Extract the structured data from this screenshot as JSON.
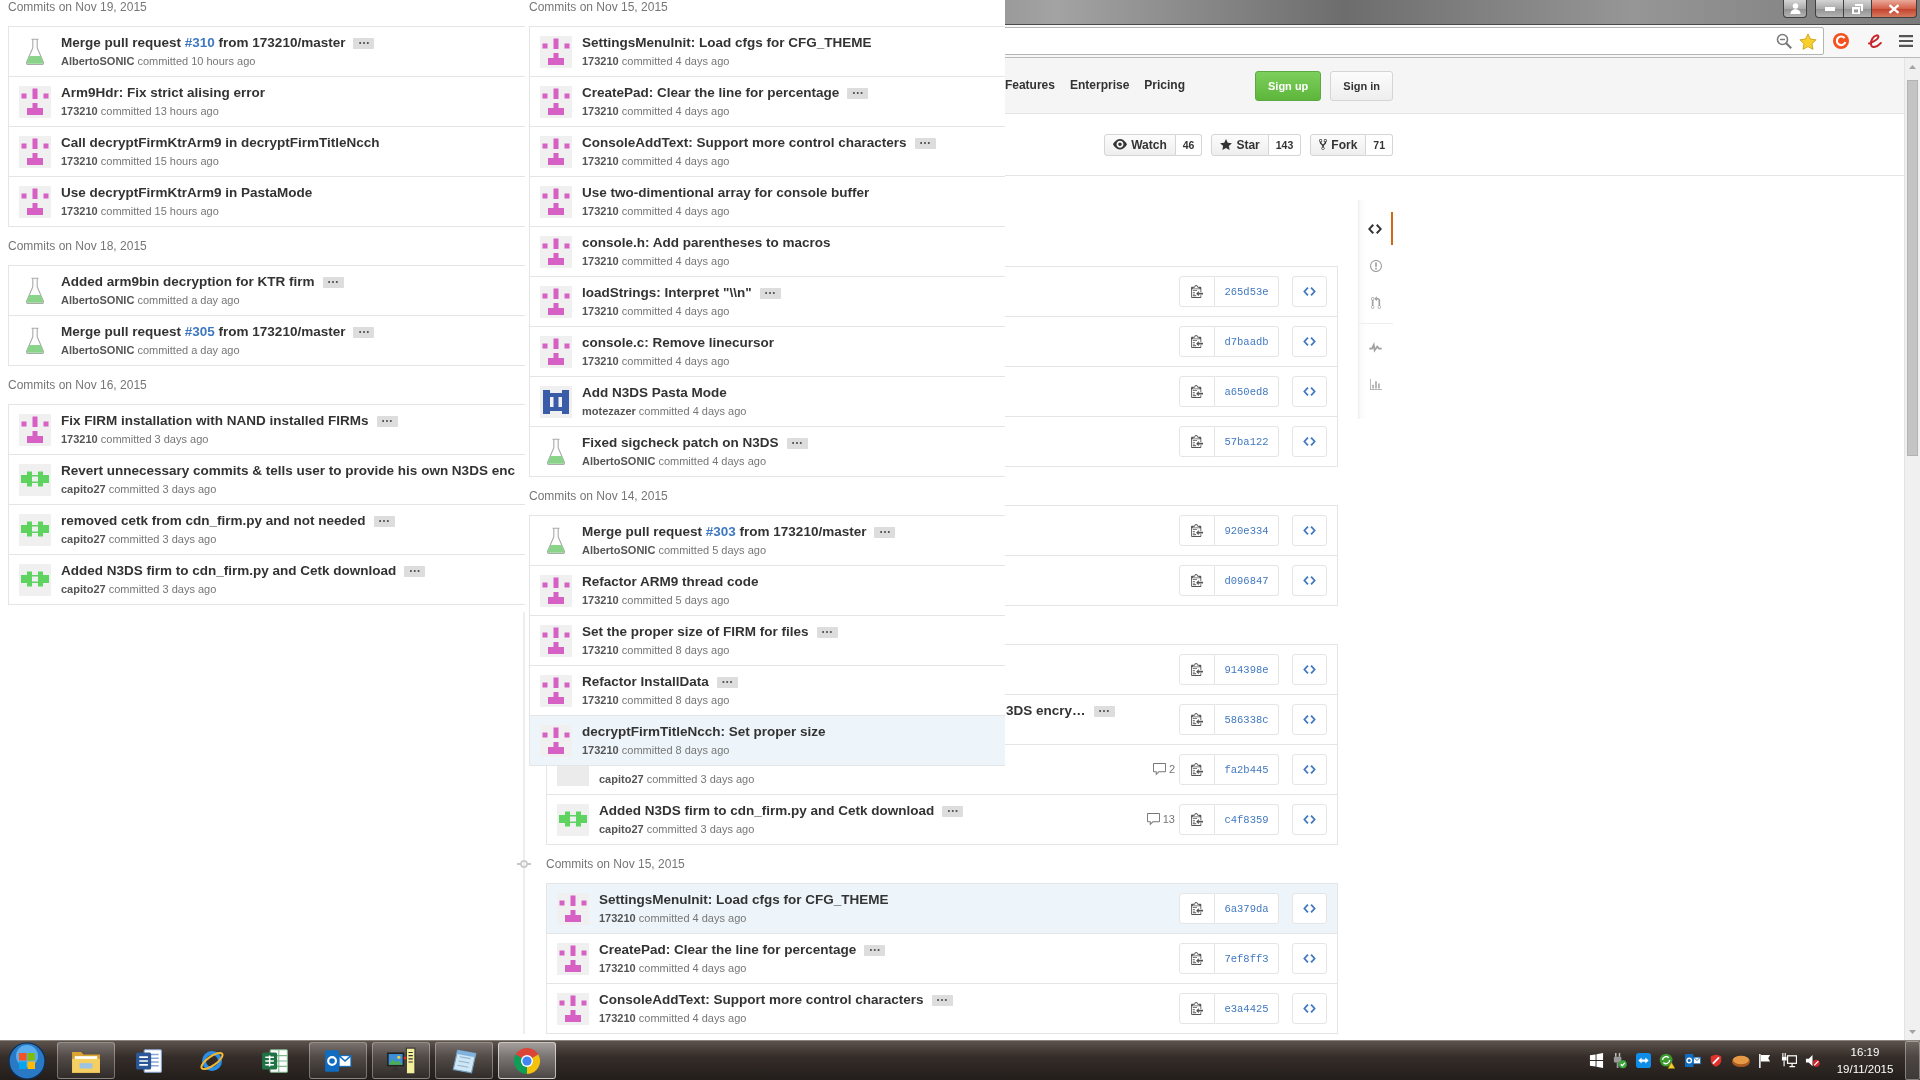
{
  "overlay_left": {
    "groups": [
      {
        "date": "Commits on Nov 19, 2015",
        "rows": [
          {
            "avatar": {
              "kind": "flask"
            },
            "title": "Merge pull request",
            "pr_link": "#310",
            "title_end": "from 173210/master",
            "expander": "…",
            "author": "AlbertoSONIC",
            "meta": "committed 10 hours ago",
            "hovered": false
          },
          {
            "avatar": {
              "kind": "tee"
            },
            "title": "Arm9Hdr: Fix strict alising error",
            "author": "173210",
            "meta": "committed 13 hours ago",
            "hovered": false
          },
          {
            "avatar": {
              "kind": "tee"
            },
            "title": "Call decryptFirmKtrArm9 in decryptFirmTitleNcch",
            "author": "173210",
            "meta": "committed 15 hours ago",
            "hovered": false
          },
          {
            "avatar": {
              "kind": "tee"
            },
            "title": "Use decryptFirmKtrArm9 in PastaMode",
            "author": "173210",
            "meta": "committed 15 hours ago",
            "hovered": false
          }
        ]
      },
      {
        "date": "Commits on Nov 18, 2015",
        "rows": [
          {
            "avatar": {
              "kind": "flask"
            },
            "title": "Added arm9bin decryption for KTR firm",
            "expander": "…",
            "author": "AlbertoSONIC",
            "meta": "committed a day ago",
            "hovered": false
          },
          {
            "avatar": {
              "kind": "flask"
            },
            "title": "Merge pull request",
            "pr_link": "#305",
            "title_end": "from 173210/master",
            "expander": "…",
            "author": "AlbertoSONIC",
            "meta": "committed a day ago",
            "hovered": false
          }
        ]
      },
      {
        "date": "Commits on Nov 16, 2015",
        "rows": [
          {
            "avatar": {
              "kind": "tee"
            },
            "title": "Fix FIRM installation with NAND installed FIRMs",
            "expander": "…",
            "author": "173210",
            "meta": "committed 3 days ago",
            "hovered": false
          },
          {
            "avatar": {
              "kind": "band"
            },
            "title": "Revert unnecessary commits & tells user to provide his own N3DS enc",
            "author": "capito27",
            "meta": "committed 3 days ago",
            "hovered": false
          },
          {
            "avatar": {
              "kind": "band"
            },
            "title": "removed cetk from cdn_firm.py and not needed",
            "expander": "…",
            "author": "capito27",
            "meta": "committed 3 days ago",
            "hovered": false
          },
          {
            "avatar": {
              "kind": "band"
            },
            "title": "Added N3DS firm to cdn_firm.py and Cetk download",
            "expander": "…",
            "author": "capito27",
            "meta": "committed 3 days ago",
            "hovered": false
          }
        ]
      }
    ]
  },
  "overlay_middle": {
    "groups": [
      {
        "date": "Commits on Nov 15, 2015",
        "rows": [
          {
            "avatar": {
              "kind": "tee"
            },
            "title": "SettingsMenuInit: Load cfgs for CFG_THEME",
            "author": "173210",
            "meta": "committed 4 days ago",
            "hovered": false
          },
          {
            "avatar": {
              "kind": "tee"
            },
            "title": "CreatePad: Clear the line for percentage",
            "expander": "…",
            "author": "173210",
            "meta": "committed 4 days ago",
            "hovered": false
          },
          {
            "avatar": {
              "kind": "tee"
            },
            "title": "ConsoleAddText: Support more control characters",
            "expander": "…",
            "author": "173210",
            "meta": "committed 4 days ago",
            "hovered": false
          },
          {
            "avatar": {
              "kind": "tee"
            },
            "title": "Use two-dimentional array for console buffer",
            "author": "173210",
            "meta": "committed 4 days ago",
            "hovered": false
          },
          {
            "avatar": {
              "kind": "tee"
            },
            "title": "console.h: Add parentheses to macros",
            "author": "173210",
            "meta": "committed 4 days ago",
            "hovered": false
          },
          {
            "avatar": {
              "kind": "tee"
            },
            "title": "loadStrings: Interpret \"\\\\n\"",
            "expander": "…",
            "author": "173210",
            "meta": "committed 4 days ago",
            "hovered": false
          },
          {
            "avatar": {
              "kind": "tee"
            },
            "title": "console.c: Remove linecursor",
            "author": "173210",
            "meta": "committed 4 days ago",
            "hovered": false
          },
          {
            "avatar": {
              "kind": "bowtie"
            },
            "title": "Add N3DS Pasta Mode",
            "author": "motezazer",
            "meta": "committed 4 days ago",
            "hovered": false
          },
          {
            "avatar": {
              "kind": "flask"
            },
            "title": "Fixed sigcheck patch on N3DS",
            "expander": "…",
            "author": "AlbertoSONIC",
            "meta": "committed 4 days ago",
            "hovered": false
          }
        ]
      },
      {
        "date": "Commits on Nov 14, 2015",
        "rows": [
          {
            "avatar": {
              "kind": "flask"
            },
            "title": "Merge pull request",
            "pr_link": "#303",
            "title_end": "from 173210/master",
            "expander": "…",
            "author": "AlbertoSONIC",
            "meta": "committed 5 days ago",
            "hovered": false
          },
          {
            "avatar": {
              "kind": "tee"
            },
            "title": "Refactor ARM9 thread code",
            "author": "173210",
            "meta": "committed 5 days ago",
            "hovered": false
          },
          {
            "avatar": {
              "kind": "tee"
            },
            "title": "Set the proper size of FIRM for files",
            "expander": "…",
            "author": "173210",
            "meta": "committed 8 days ago",
            "hovered": false
          },
          {
            "avatar": {
              "kind": "tee"
            },
            "title": "Refactor InstallData",
            "expander": "…",
            "author": "173210",
            "meta": "committed 8 days ago",
            "hovered": false
          },
          {
            "avatar": {
              "kind": "tee"
            },
            "title": "decryptFirmTitleNcch: Set proper size",
            "author": "173210",
            "meta": "committed 8 days ago",
            "hovered": true
          }
        ]
      }
    ]
  },
  "page": {
    "nav": [
      "Features",
      "Enterprise",
      "Pricing"
    ],
    "auth_buttons": [
      {
        "kind": "primary",
        "label": "Sign up"
      },
      {
        "kind": "default",
        "label": "Sign in"
      }
    ],
    "repo_actions": [
      {
        "kind": "watch",
        "label": "Watch",
        "count": "46"
      },
      {
        "kind": "star",
        "label": "Star",
        "count": "143"
      },
      {
        "kind": "fork",
        "label": "Fork",
        "count": "71"
      }
    ],
    "commits": {
      "groups": [
        {
          "rows": [
            {
              "sha": "265d53e",
              "hovered": false
            },
            {
              "sha": "d7baadb",
              "hovered": false
            },
            {
              "sha": "a650ed8",
              "hovered": false
            },
            {
              "sha": "57ba122",
              "hovered": false
            }
          ]
        },
        {
          "rows": [
            {
              "sha": "920e334",
              "hovered": false
            },
            {
              "sha": "d096847",
              "hovered": false
            }
          ]
        },
        {
          "rows": [
            {
              "sha": "914398e",
              "hovered": false
            },
            {
              "title": "3DS encry…",
              "expander": "…",
              "sha": "586338c",
              "hovered": false
            },
            {
              "avatar": {
                "kind": "tile"
              },
              "author": "capito27",
              "meta": "committed 3 days ago",
              "comments": "2",
              "sha": "fa2b445",
              "hovered": false
            },
            {
              "avatar": {
                "kind": "band"
              },
              "title": "Added N3DS firm to cdn_firm.py and Cetk download",
              "expander": "…",
              "author": "capito27",
              "meta": "committed 3 days ago",
              "comments": "13",
              "sha": "c4f8359",
              "hovered": false
            }
          ]
        },
        {
          "date": "Commits on Nov 15, 2015",
          "rows": [
            {
              "avatar": {
                "kind": "tee"
              },
              "title": "SettingsMenuInit: Load cfgs for CFG_THEME",
              "author": "173210",
              "meta": "committed 4 days ago",
              "sha": "6a379da",
              "hovered": true
            },
            {
              "avatar": {
                "kind": "tee"
              },
              "title": "CreatePad: Clear the line for percentage",
              "expander": "…",
              "author": "173210",
              "meta": "committed 4 days ago",
              "sha": "7ef8ff3",
              "hovered": false
            },
            {
              "avatar": {
                "kind": "tee"
              },
              "title": "ConsoleAddText: Support more control characters",
              "expander": "…",
              "author": "173210",
              "meta": "committed 4 days ago",
              "sha": "e3a4425",
              "hovered": false
            }
          ]
        }
      ]
    },
    "repo_nav": {
      "groups": [
        [
          {
            "kind": "code",
            "selected": true
          },
          {
            "kind": "issues",
            "selected": false
          },
          {
            "kind": "pulls",
            "selected": false
          }
        ],
        [
          {
            "kind": "pulse",
            "selected": false
          },
          {
            "kind": "graphs",
            "selected": false
          }
        ]
      ]
    }
  },
  "taskbar": {
    "apps": [
      {
        "kind": "folder",
        "running": true,
        "selected": false
      },
      {
        "kind": "document",
        "running": false,
        "selected": false
      },
      {
        "kind": "orbit",
        "running": false,
        "selected": false
      },
      {
        "kind": "spreadsheet",
        "running": false,
        "selected": false
      },
      {
        "kind": "envelope",
        "running": true,
        "selected": false
      },
      {
        "kind": "computer",
        "running": true,
        "selected": false
      },
      {
        "kind": "notepad",
        "running": true,
        "selected": false
      },
      {
        "kind": "segments",
        "running": true,
        "selected": true
      }
    ],
    "tray": [
      {
        "kind": "grid"
      },
      {
        "kind": "plug"
      },
      {
        "kind": "arrows"
      },
      {
        "kind": "sync"
      },
      {
        "kind": "envelope"
      },
      {
        "kind": "shield"
      },
      {
        "kind": "oval"
      },
      {
        "kind": "flag"
      },
      {
        "kind": "network"
      },
      {
        "kind": "speaker"
      }
    ],
    "clock": {
      "time": "16:19",
      "date": "19/11/2015"
    }
  }
}
